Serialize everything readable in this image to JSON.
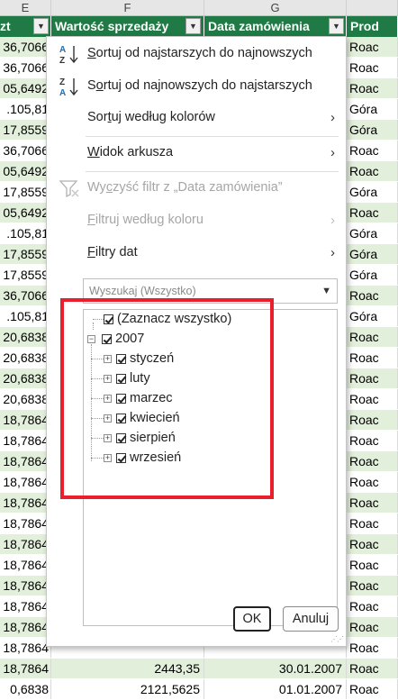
{
  "columns": {
    "E": "E",
    "F": "F",
    "G": "G"
  },
  "headers": {
    "colE": "zt",
    "colF": "Wartość sprzedaży",
    "colG": "Data zamówienia",
    "colH": "Prod"
  },
  "rows": [
    {
      "e": "36,7066",
      "f": "",
      "g": "",
      "h": "Roac"
    },
    {
      "e": "36,7066",
      "f": "",
      "g": "",
      "h": "Roac"
    },
    {
      "e": "05,6492",
      "f": "",
      "g": "",
      "h": "Roac"
    },
    {
      "e": ".105,81",
      "f": "",
      "g": "",
      "h": "Góra"
    },
    {
      "e": "17,8559",
      "f": "",
      "g": "",
      "h": "Góra"
    },
    {
      "e": "36,7066",
      "f": "",
      "g": "",
      "h": "Roac"
    },
    {
      "e": "05,6492",
      "f": "",
      "g": "",
      "h": "Roac"
    },
    {
      "e": "17,8559",
      "f": "",
      "g": "",
      "h": "Góra"
    },
    {
      "e": "05,6492",
      "f": "",
      "g": "",
      "h": "Roac"
    },
    {
      "e": ".105,81",
      "f": "",
      "g": "",
      "h": "Góra"
    },
    {
      "e": "17,8559",
      "f": "",
      "g": "",
      "h": "Góra"
    },
    {
      "e": "17,8559",
      "f": "",
      "g": "",
      "h": "Góra"
    },
    {
      "e": "36,7066",
      "f": "",
      "g": "",
      "h": "Roac"
    },
    {
      "e": ".105,81",
      "f": "",
      "g": "",
      "h": "Góra"
    },
    {
      "e": "20,6838",
      "f": "",
      "g": "",
      "h": "Roac"
    },
    {
      "e": "20,6838",
      "f": "",
      "g": "",
      "h": "Roac"
    },
    {
      "e": "20,6838",
      "f": "",
      "g": "",
      "h": "Roac"
    },
    {
      "e": "20,6838",
      "f": "",
      "g": "",
      "h": "Roac"
    },
    {
      "e": "18,7864",
      "f": "",
      "g": "",
      "h": "Roac"
    },
    {
      "e": "18,7864",
      "f": "",
      "g": "",
      "h": "Roac"
    },
    {
      "e": "18,7864",
      "f": "",
      "g": "",
      "h": "Roac"
    },
    {
      "e": "18,7864",
      "f": "",
      "g": "",
      "h": "Roac"
    },
    {
      "e": "18,7864",
      "f": "",
      "g": "",
      "h": "Roac"
    },
    {
      "e": "18,7864",
      "f": "",
      "g": "",
      "h": "Roac"
    },
    {
      "e": "18,7864",
      "f": "",
      "g": "",
      "h": "Roac"
    },
    {
      "e": "18,7864",
      "f": "",
      "g": "",
      "h": "Roac"
    },
    {
      "e": "18,7864",
      "f": "",
      "g": "",
      "h": "Roac"
    },
    {
      "e": "18,7864",
      "f": "",
      "g": "",
      "h": "Roac"
    },
    {
      "e": "18,7864",
      "f": "",
      "g": "",
      "h": "Roac"
    },
    {
      "e": "18,7864",
      "f": "",
      "g": "",
      "h": "Roac"
    },
    {
      "e": "18,7864",
      "f": "2443,35",
      "g": "30.01.2007",
      "h": "Roac"
    },
    {
      "e": "0,6838",
      "f": "2121,5625",
      "g": "01.01.2007",
      "h": "Roac"
    }
  ],
  "menu": {
    "sort_asc": {
      "pre": "",
      "u": "S",
      "post": "ortuj od najstarszych do najnowszych"
    },
    "sort_desc": {
      "pre": "S",
      "u": "o",
      "post": "rtuj od najnowszych do najstarszych"
    },
    "sort_color": {
      "pre": "Sor",
      "u": "t",
      "post": "uj według kolorów"
    },
    "sheet_view": {
      "pre": "",
      "u": "W",
      "post": "idok arkusza"
    },
    "clear_filter": {
      "pre": "Wy",
      "u": "c",
      "post": "zyść filtr z „Data zamówienia”"
    },
    "filter_color": {
      "pre": "",
      "u": "F",
      "post": "iltruj według koloru"
    },
    "date_filters": {
      "pre": "",
      "u": "F",
      "post": "iltry dat"
    },
    "search_placeholder": "Wyszukaj (Wszystko)",
    "tree": {
      "select_all": "(Zaznacz wszystko)",
      "year": "2007",
      "months": [
        "styczeń",
        "luty",
        "marzec",
        "kwiecień",
        "sierpień",
        "wrzesień"
      ]
    },
    "ok": "OK",
    "cancel": "Anuluj"
  },
  "colors": {
    "header_green": "#1f7a45",
    "band_green": "#e2efda",
    "highlight": "#e8202d"
  }
}
